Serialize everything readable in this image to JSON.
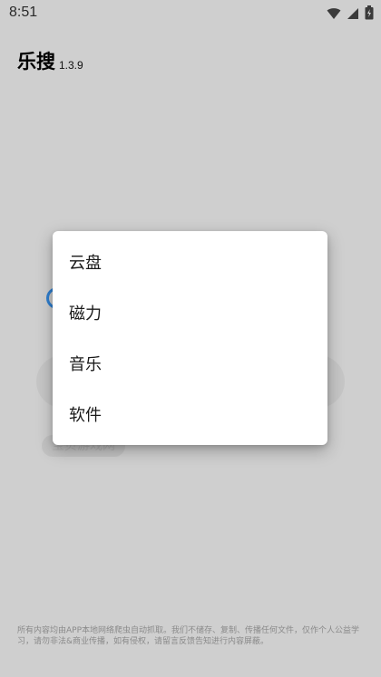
{
  "status_bar": {
    "time": "8:51",
    "icons": [
      "wifi-icon",
      "signal-icon",
      "battery-icon"
    ]
  },
  "header": {
    "title": "乐搜",
    "version": "1.3.9"
  },
  "background": {
    "chip_label": "宝贝游戏网",
    "logo_right_char": "!"
  },
  "menu": {
    "items": [
      {
        "label": "云盘"
      },
      {
        "label": "磁力"
      },
      {
        "label": "音乐"
      },
      {
        "label": "软件"
      }
    ]
  },
  "footer": {
    "disclaimer": "所有内容均由APP本地网络爬虫自动抓取。我们不储存、复制、传播任何文件，仅作个人公益学习，请勿非法&商业传播，如有侵权，请留言反馈告知进行内容屏蔽。"
  },
  "colors": {
    "overlay_bg": "#cfcfcf",
    "menu_bg": "#ffffff",
    "accent": "#2f7fd0"
  }
}
